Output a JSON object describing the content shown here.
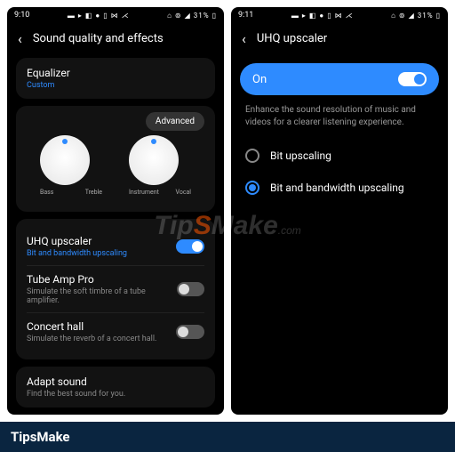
{
  "left": {
    "status": {
      "time": "9:10",
      "icons_l": "▬ ▸ ◧ ● ▯ ⋈ ⋌",
      "icons_r": "⌂ ⊚ ◢ 31% ▯"
    },
    "header": "Sound quality and effects",
    "equalizer": {
      "title": "Equalizer",
      "sub": "Custom"
    },
    "advanced": "Advanced",
    "knobs": [
      {
        "l": "Bass",
        "r": "Treble"
      },
      {
        "l": "Instrument",
        "r": "Vocal"
      }
    ],
    "items": [
      {
        "title": "UHQ upscaler",
        "sub": "Bit and bandwidth upscaling",
        "on": true,
        "blue": true
      },
      {
        "title": "Tube Amp Pro",
        "sub": "Simulate the soft timbre of a tube amplifier.",
        "on": false
      },
      {
        "title": "Concert hall",
        "sub": "Simulate the reverb of a concert hall.",
        "on": false
      }
    ],
    "adapt": {
      "title": "Adapt sound",
      "sub": "Find the best sound for you."
    }
  },
  "right": {
    "status": {
      "time": "9:11",
      "icons_l": "▬ ▸ ◧ ● ▯ ⋈ ⋌",
      "icons_r": "⌂ ⊚ ◢ 31% ▯"
    },
    "header": "UHQ upscaler",
    "on_label": "On",
    "desc": "Enhance the sound resolution of music and videos for a clearer listening experience.",
    "opts": [
      {
        "label": "Bit upscaling",
        "sel": false
      },
      {
        "label": "Bit and bandwidth upscaling",
        "sel": true
      }
    ]
  },
  "watermark": {
    "pre": "Tip",
    "s": "S",
    "post": "Make",
    "com": ".com"
  },
  "footer": "TipsMake"
}
